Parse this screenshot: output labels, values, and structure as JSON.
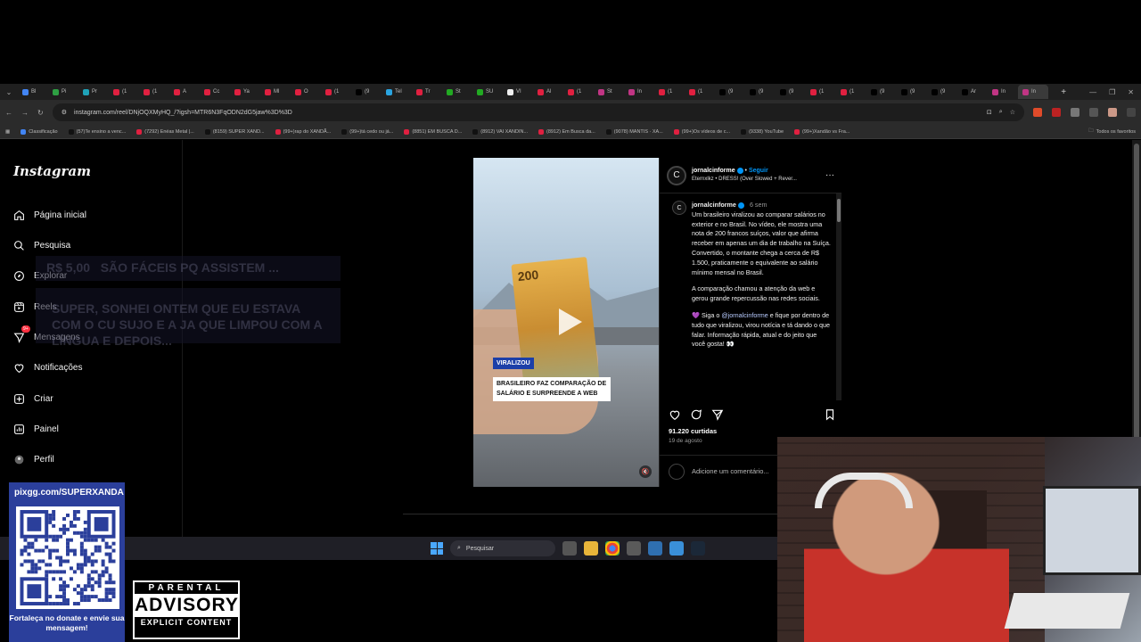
{
  "browser": {
    "url": "instagram.com/reel/DNjOQXMyHQ_/?igsh=MTR6N3FqODN2dG5jaw%3D%3D",
    "tabs": [
      "Bl",
      "Pi",
      "Pr",
      "(1",
      "(1",
      "A",
      "Cc",
      "Ya",
      "Ml",
      "O",
      "(1",
      "(9",
      "Tel",
      "Tr",
      "St",
      "SU",
      "VI",
      "Al",
      "(1",
      "St",
      "In",
      "(1",
      "(1",
      "(9",
      "(9",
      "(9",
      "(1",
      "(1",
      "(9",
      "(9",
      "(9",
      "Ar",
      "In",
      "In"
    ],
    "bookmarks": [
      "Classificação",
      "(57)Te ensino a venc...",
      "(7292) Enéas Metal |...",
      "(8159) SUPER XAND...",
      "(99+)rap do XANDÃ...",
      "(99+)tá cedo ou já...",
      "(8851) EM BUSCA D...",
      "(8912) VAI XANDIN...",
      "(8912) Em Busca da...",
      "(9078) MANTIS · XA...",
      "(99+)Os vídeos de c...",
      "(9338) YouTube",
      "(99+)Xandão vs Fra..."
    ],
    "all_bookmarks": "Todos os favoritos"
  },
  "instagram": {
    "logo": "Instagram",
    "nav": [
      {
        "label": "Página inicial",
        "icon": "home-icon"
      },
      {
        "label": "Pesquisa",
        "icon": "search-icon"
      },
      {
        "label": "Explorar",
        "icon": "compass-icon"
      },
      {
        "label": "Reels",
        "icon": "reels-icon"
      },
      {
        "label": "Mensagens",
        "icon": "messenger-icon",
        "badge": "9+"
      },
      {
        "label": "Notificações",
        "icon": "heart-icon"
      },
      {
        "label": "Criar",
        "icon": "plus-square-icon"
      },
      {
        "label": "Painel",
        "icon": "dashboard-icon"
      },
      {
        "label": "Perfil",
        "icon": "profile-icon"
      }
    ],
    "ghost_donation": {
      "amount": "R$ 5,00",
      "title": "SÃO FÁCEIS PQ ASSISTEM ...",
      "message": "SUPER, SONHEI ONTEM QUE EU ESTAVA COM O CU SUJO E A JA QUE LIMPOU COM A LÍNGUA E DEPOIS..."
    },
    "reel": {
      "note_value": "200",
      "tag": "VIRALIZOU",
      "headline": "BRASILEIRO FAZ COMPARAÇÃO DE SALÁRIO E SURPREENDE A WEB"
    },
    "post": {
      "username": "jornalcinforme",
      "follow": "Seguir",
      "audio": "Eternxlkz • DRESS! (Over Slowed + Rever...",
      "avatar_letter": "C",
      "time": "6 sem",
      "caption_1": "Um brasileiro viralizou ao comparar salários no exterior e no Brasil. No vídeo, ele mostra uma nota de 200 francos suíços, valor que afirma receber em apenas um dia de trabalho na Suíça. Convertido, o montante chega a cerca de R$ 1.500, praticamente o equivalente ao salário mínimo mensal no Brasil.",
      "caption_2": "A comparação chamou a atenção da web e gerou grande repercussão nas redes sociais.",
      "caption_3_prefix": "💜 Siga o ",
      "caption_3_mention": "@jornalcinforme",
      "caption_3_suffix": " e fique por dentro de tudo que viralizou, virou notícia e tá dando o que falar. Informação rápida, atual e do jeito que você gosta! 👀",
      "likes": "91.220 curtidas",
      "date": "19 de agosto",
      "comment_placeholder": "Adicione um comentário..."
    }
  },
  "taskbar": {
    "search_placeholder": "Pesquisar"
  },
  "overlay": {
    "pix_url": "pixgg.com/SUPERXANDA",
    "pix_message": "Fortaleça no donate e envie sua mensagem!",
    "advisory_top": "PARENTAL",
    "advisory_mid": "ADVISORY",
    "advisory_bottom": "EXPLICIT CONTENT"
  },
  "colors": {
    "accent_blue": "#0095f6",
    "notification_red": "#ff3040",
    "pix_blue": "#2b3f9b"
  }
}
